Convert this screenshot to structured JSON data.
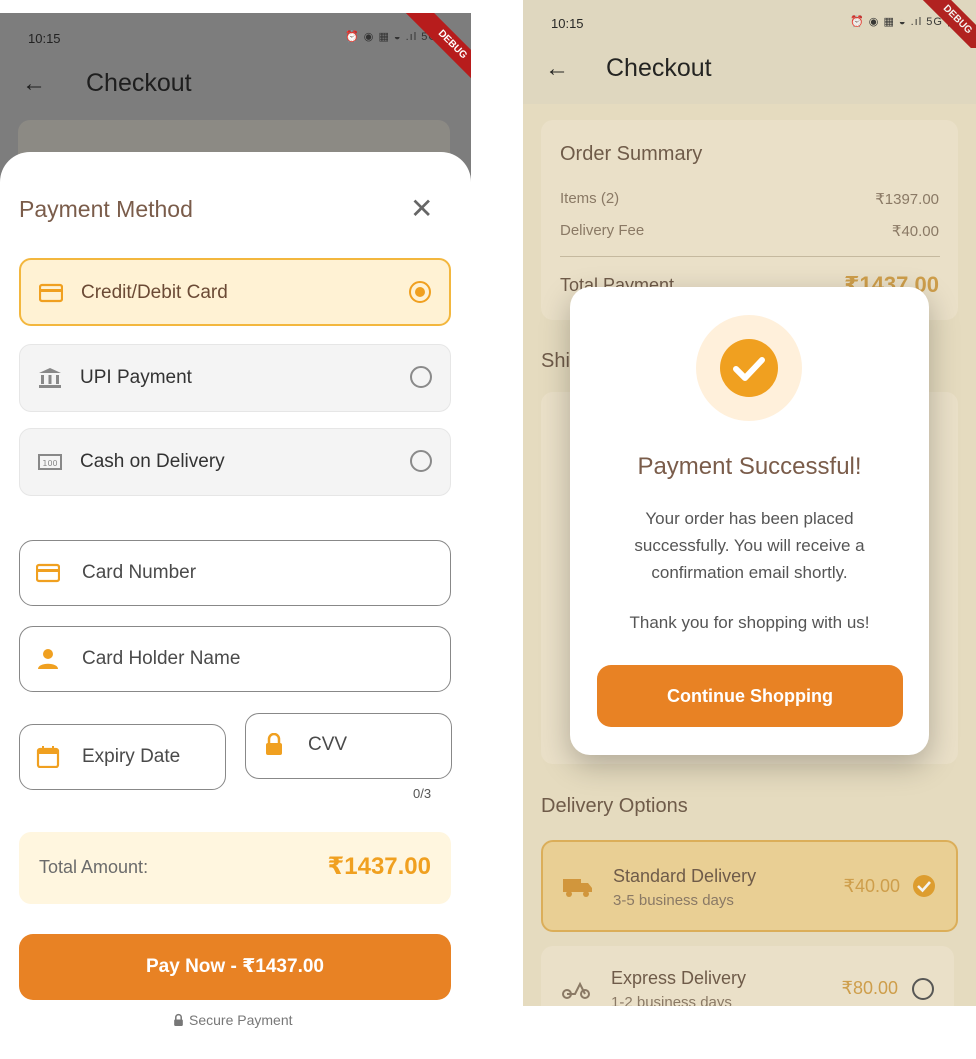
{
  "left": {
    "status_time": "10:15",
    "status_icons": "⏰ ◉ ▦ ◒ .ıl 5G ▮",
    "debug_banner": "DEBUG",
    "app_title": "Checkout",
    "sheet_title": "Payment Method",
    "options": [
      {
        "label": "Credit/Debit Card",
        "icon": "credit-card-icon",
        "selected": true
      },
      {
        "label": "UPI Payment",
        "icon": "bank-icon",
        "selected": false
      },
      {
        "label": "Cash on Delivery",
        "icon": "cash-icon",
        "selected": false
      }
    ],
    "fields": {
      "card_number": "Card Number",
      "card_holder": "Card Holder Name",
      "expiry": "Expiry Date",
      "cvv": "CVV",
      "cvv_counter": "0/3"
    },
    "total_label": "Total Amount:",
    "total_value": "₹1437.00",
    "pay_button": "Pay Now - ₹1437.00",
    "secure_text": "Secure Payment",
    "accent": "#f0a020",
    "button_color": "#e88224"
  },
  "right": {
    "status_time": "10:15",
    "status_icons": "⏰ ◉ ▦ ◒ .ıl 5G ▮",
    "debug_banner": "DEBUG",
    "app_title": "Checkout",
    "summary": {
      "title": "Order Summary",
      "items_label": "Items (2)",
      "items_value": "₹1397.00",
      "fee_label": "Delivery Fee",
      "fee_value": "₹40.00",
      "total_label": "Total Payment",
      "total_value": "₹1437.00"
    },
    "shipping_partial": "Shi",
    "modal": {
      "title": "Payment Successful!",
      "message": "Your order has been placed successfully. You will receive a confirmation email shortly.",
      "thanks": "Thank you for shopping with us!",
      "button": "Continue Shopping"
    },
    "delivery": {
      "title": "Delivery Options",
      "options": [
        {
          "name": "Standard Delivery",
          "days": "3-5 business days",
          "price": "₹40.00",
          "selected": true
        },
        {
          "name": "Express Delivery",
          "days": "1-2 business days",
          "price": "₹80.00",
          "selected": false
        }
      ]
    }
  }
}
